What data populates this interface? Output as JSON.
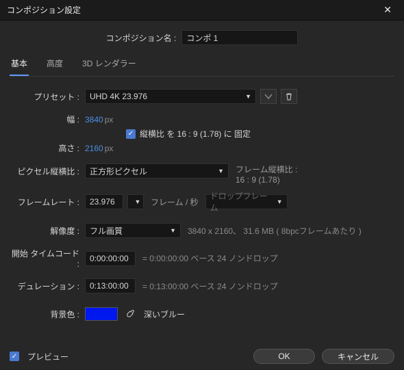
{
  "title": "コンポジション設定",
  "compNameLabel": "コンポジション名 :",
  "compName": "コンポ 1",
  "tabs": {
    "basic": "基本",
    "advanced": "高度",
    "renderer": "3D レンダラー"
  },
  "presetLabel": "プリセット :",
  "presetValue": "UHD 4K 23.976",
  "widthLabel": "幅 :",
  "widthValue": "3840",
  "heightLabel": "高さ :",
  "heightValue": "2160",
  "pxUnit": "px",
  "lockAspectLabel": "縦横比 を 16 : 9 (1.78) に 固定",
  "pixelAspectLabel": "ピクセル縦横比 :",
  "pixelAspectValue": "正方形ピクセル",
  "frameAspectLabel": "フレーム縦横比 :",
  "frameAspectValue": "16 : 9 (1.78)",
  "frameRateLabel": "フレームレート :",
  "frameRateValue": "23.976",
  "frameRateUnit": "フレーム / 秒",
  "dropFrameValue": "ドロップフレーム",
  "resolutionLabel": "解像度 :",
  "resolutionValue": "フル画質",
  "resolutionInfo": "3840 x 2160、 31.6 MB ( 8bpcフレームあたり )",
  "startTimecodeLabel": "開始 タイムコード :",
  "startTimecodeValue": "0:00:00:00",
  "startTimecodeInfo": "= 0:00:00:00 ベース 24  ノンドロップ",
  "durationLabel": "デュレーション :",
  "durationValue": "0:13:00:00",
  "durationInfo": "= 0:13:00:00 ベース 24  ノンドロップ",
  "bgColorLabel": "背景色 :",
  "bgColorHex": "#0018ee",
  "bgColorName": "深いブルー",
  "previewLabel": "プレビュー",
  "okLabel": "OK",
  "cancelLabel": "キャンセル"
}
